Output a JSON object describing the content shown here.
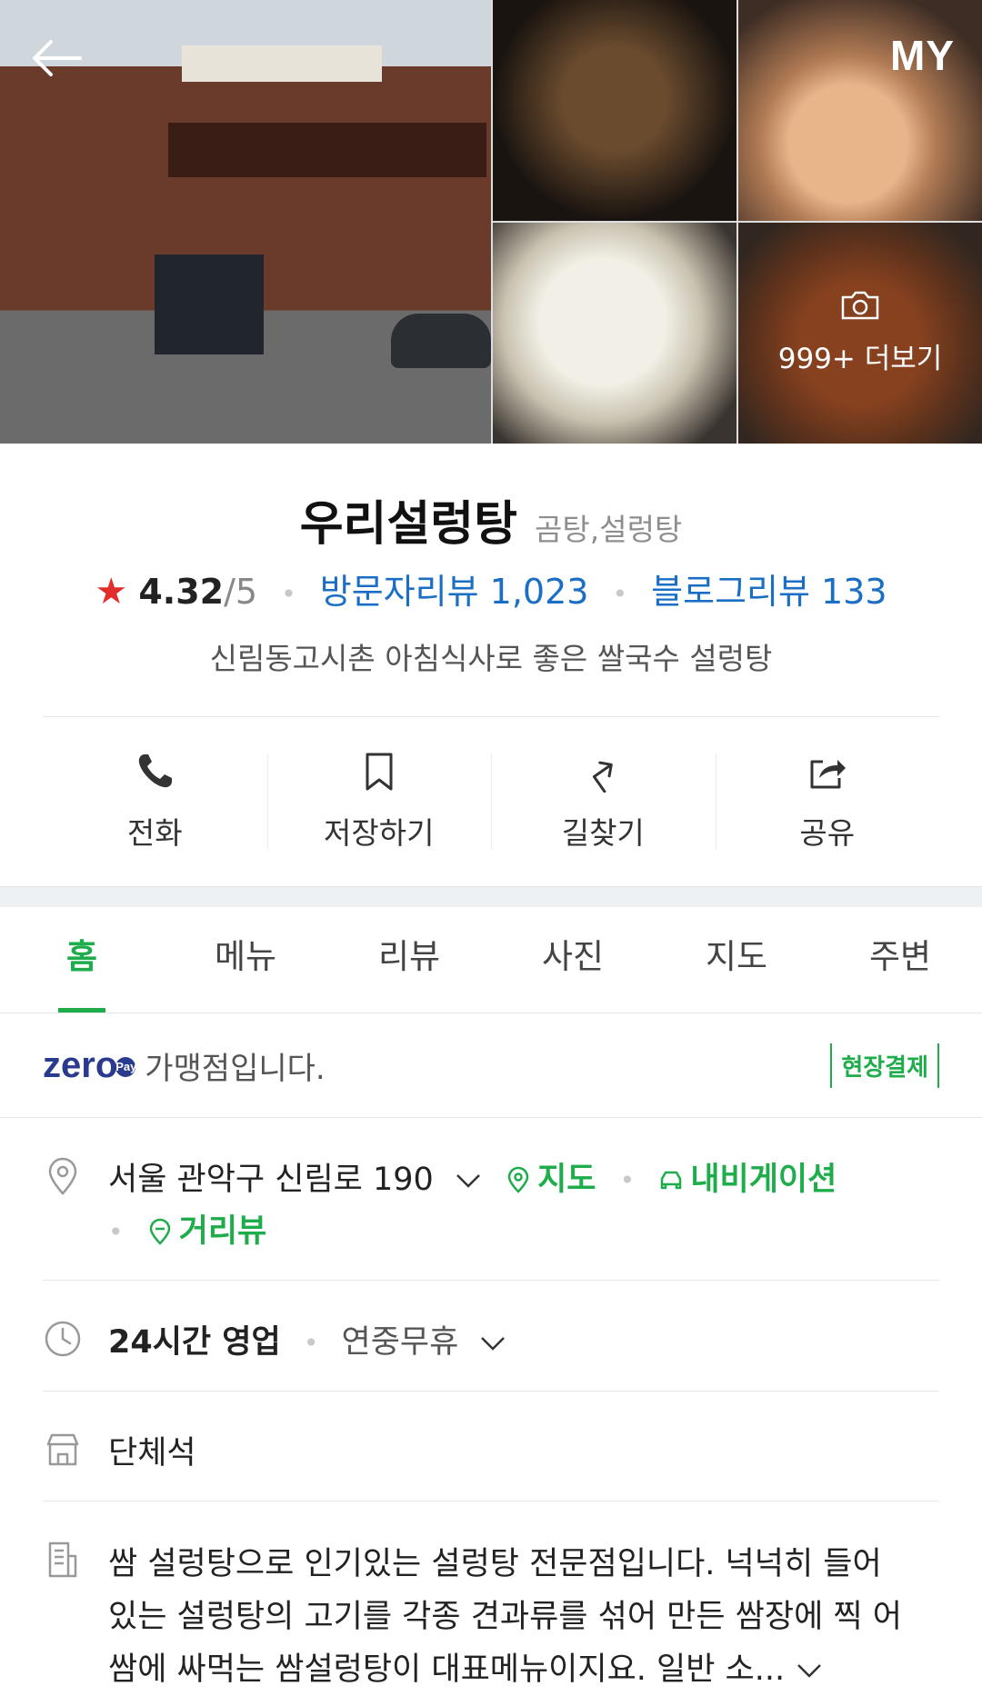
{
  "header": {
    "my_label": "MY",
    "more_photos": "999+ 더보기"
  },
  "place": {
    "name": "우리설렁탕",
    "category": "곰탕,설렁탕",
    "rating": "4.32",
    "rating_max": "/5",
    "visitor_reviews": "방문자리뷰 1,023",
    "blog_reviews": "블로그리뷰 133",
    "description": "신림동고시촌 아침식사로 좋은 쌀국수 설렁탕"
  },
  "actions": [
    {
      "label": "전화",
      "icon": "phone-icon"
    },
    {
      "label": "저장하기",
      "icon": "bookmark-icon"
    },
    {
      "label": "길찾기",
      "icon": "directions-icon"
    },
    {
      "label": "공유",
      "icon": "share-icon"
    }
  ],
  "tabs": [
    "홈",
    "메뉴",
    "리뷰",
    "사진",
    "지도",
    "주변"
  ],
  "zeropay": {
    "logo": "zero",
    "logo_pay": "Pay",
    "text": "가맹점입니다.",
    "badge": "현장결제"
  },
  "address": {
    "text": "서울 관악구 신림로 190",
    "map": "지도",
    "navigation": "내비게이션",
    "street_view": "거리뷰"
  },
  "hours": {
    "status": "24시간 영업",
    "note": "연중무휴"
  },
  "facility": "단체석",
  "intro": {
    "line1": "쌈 설렁탕으로 인기있는 설렁탕 전문점입니다. 넉넉히 들어",
    "line2": "있는 설렁탕의 고기를 각종 견과류를 섞어 만든 쌈장에 찍 어",
    "line3": "쌈에 싸먹는 쌈설렁탕이 대표메뉴이지요. 일반 소..."
  },
  "colors": {
    "accent": "#1fad4c",
    "link": "#1a6fc4",
    "star": "#e32d2d"
  }
}
